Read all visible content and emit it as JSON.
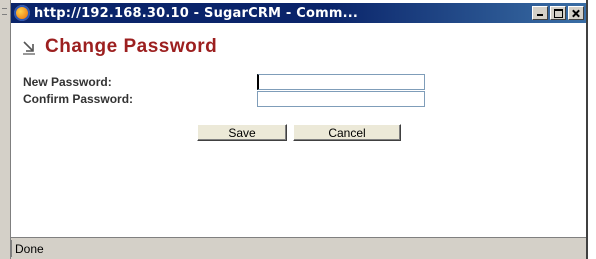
{
  "window": {
    "title": "http://192.168.30.10 - SugarCRM - Comm...",
    "icon": "firefox-globe-icon"
  },
  "form": {
    "title": "Change Password",
    "title_icon": "arrow-icon",
    "new_password_label": "New Password:",
    "new_password_value": "",
    "confirm_password_label": "Confirm Password:",
    "confirm_password_value": ""
  },
  "buttons": {
    "save_label": "Save",
    "cancel_label": "Cancel"
  },
  "status": {
    "text": "Done"
  },
  "colors": {
    "title_color": "#9c1f1f",
    "titlebar": "#0a246a"
  }
}
